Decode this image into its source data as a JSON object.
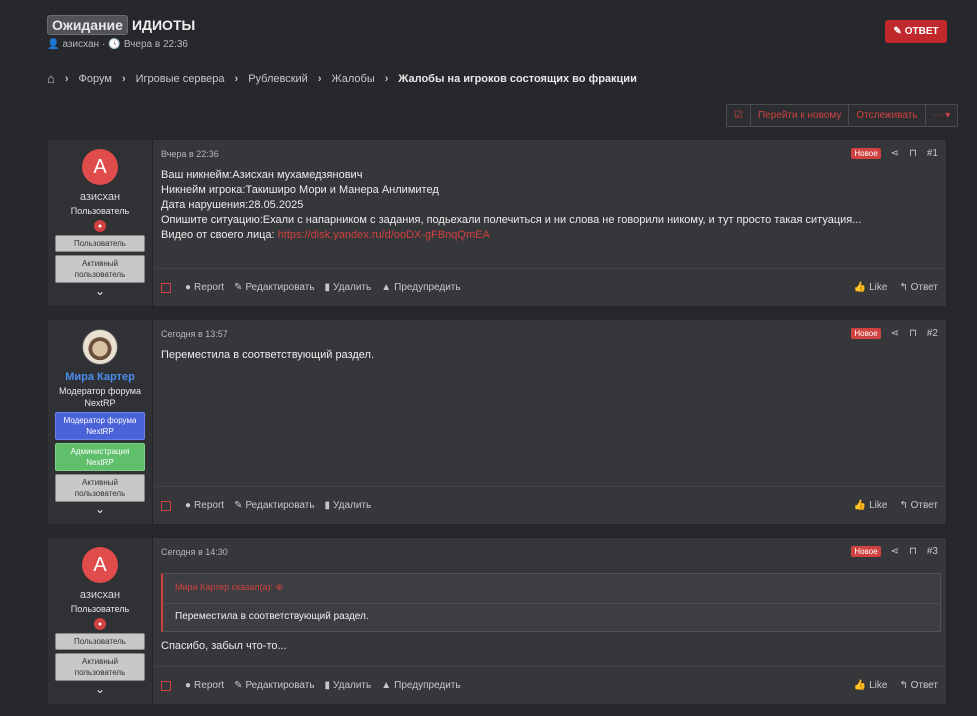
{
  "thread": {
    "prefix": "Ожидание",
    "title": "ИДИОТЫ",
    "author": "азисхан",
    "dot": "·",
    "date": "Вчера в 22:36",
    "reply_button": "ОТВЕТ"
  },
  "breadcrumbs": [
    "Форум",
    "Игровые сервера",
    "Рублевский",
    "Жалобы",
    "Жалобы на игроков состоящих во фракции"
  ],
  "actions": {
    "go_new": "Перейти к новому",
    "watch": "Отслеживать",
    "more": "⋯"
  },
  "posts": [
    {
      "username": "азисхан",
      "user_title": "Пользователь",
      "banners": [
        "Пользователь",
        "Активный пользователь"
      ],
      "date": "Вчера в 22:36",
      "badge": "Новое",
      "number": "#1",
      "lines": [
        "Ваш никнейм:Азисхан мухамедзянович",
        "Никнейм игрока:Такиширо Мори и Манера Анлимитед",
        "Дата нарушения:28.05.2025",
        "Опишите ситуацию:Ехали с напарником с задания, подьехали полечиться и ни слова не говорили никому, и тут просто такая ситуация..."
      ],
      "video_label": "Видео от своего лица: ",
      "video_link": "https://disk.yandex.ru/d/ooDX-gFBnqQmEA",
      "footer": [
        "Report",
        "Редактировать",
        "Удалить",
        "Предупредить"
      ],
      "like": "Like",
      "reply": "Ответ"
    },
    {
      "username": "Мира Картер",
      "user_title": "Модератор форума NextRP",
      "banners": [
        "Модератор форума NextRP",
        "Администрация NextRP",
        "Активный пользователь"
      ],
      "date": "Сегодня в 13:57",
      "badge": "Новое",
      "number": "#2",
      "text": "Переместила в соответствующий раздел.",
      "footer": [
        "Report",
        "Редактировать",
        "Удалить"
      ],
      "like": "Like",
      "reply": "Ответ"
    },
    {
      "username": "азисхан",
      "user_title": "Пользователь",
      "banners": [
        "Пользователь",
        "Активный пользователь"
      ],
      "date": "Сегодня в 14:30",
      "badge": "Новое",
      "number": "#3",
      "quote_header": "Мира Картер сказал(а): ⊕",
      "quote_text": "Переместила в соответствующий раздел.",
      "text": "Спасибо, забыл что-то...",
      "footer": [
        "Report",
        "Редактировать",
        "Удалить",
        "Предупредить"
      ],
      "like": "Like",
      "reply": "Ответ"
    }
  ],
  "colors": {
    "accent": "#d0423f",
    "background": "#26282c",
    "post": "#35373b"
  }
}
